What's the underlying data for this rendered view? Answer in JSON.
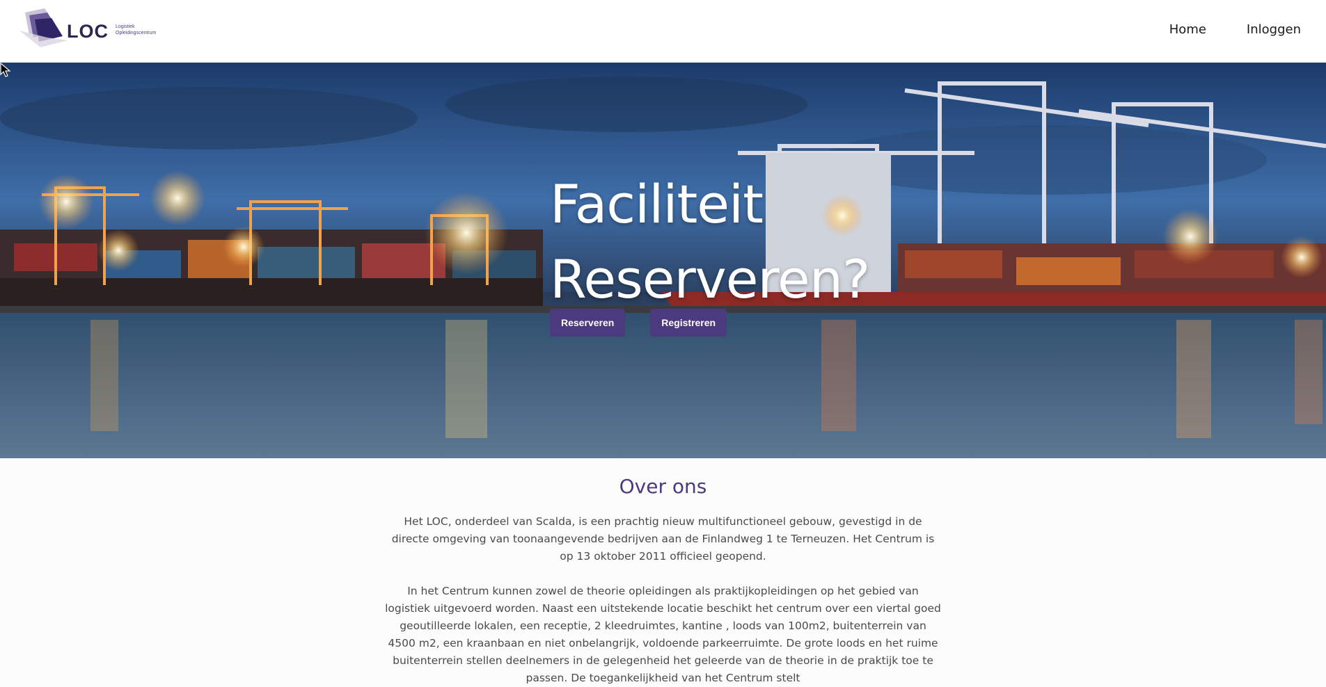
{
  "header": {
    "logo": {
      "name": "LOC",
      "subtitle_line1": "Logistiek",
      "subtitle_line2": "Opleidingscentrum",
      "icon": "loc-logo-mark"
    },
    "nav": [
      {
        "label": "Home"
      },
      {
        "label": "Inloggen"
      }
    ]
  },
  "hero": {
    "title_line1": "Faciliteit",
    "title_line2": "Reserveren?",
    "buttons": [
      {
        "label": "Reserveren"
      },
      {
        "label": "Registreren"
      }
    ],
    "background": "harbor-night-photo"
  },
  "about": {
    "title": "Over ons",
    "paragraphs": [
      "Het LOC, onderdeel van Scalda, is een prachtig nieuw multifunctioneel gebouw, gevestigd in de directe omgeving van toonaangevende bedrijven aan de Finlandweg 1 te Terneuzen. Het Centrum is op 13 oktober 2011 officieel geopend.",
      "In het Centrum kunnen zowel de theorie opleidingen als praktijkopleidingen op het gebied van logistiek uitgevoerd worden. Naast een uitstekende locatie beschikt het centrum over een viertal goed geoutilleerde lokalen, een receptie, 2 kleedruimtes, kantine , loods van 100m2, buitenterrein van 4500 m2, een kraanbaan en niet onbelangrijk, voldoende parkeerruimte. De grote loods en het ruime buitenterrein stellen deelnemers in de gelegenheid het geleerde van de theorie in de praktijk toe te passen. De toegankelijkheid van het Centrum stelt"
    ]
  },
  "colors": {
    "accent": "#4b3a7e",
    "header_bg": "#ffffff",
    "page_bg": "#fcfcfc"
  }
}
